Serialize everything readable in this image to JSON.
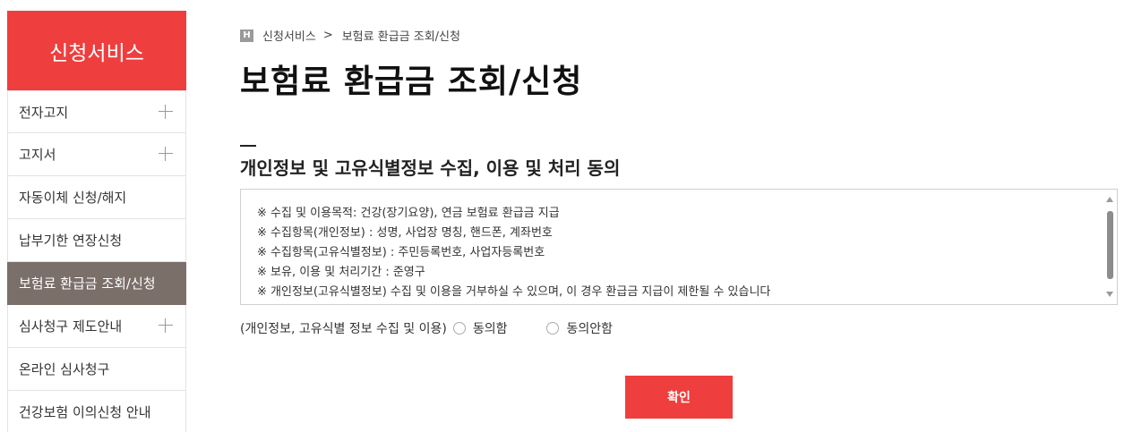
{
  "sidebar": {
    "title": "신청서비스",
    "items": [
      {
        "label": "전자고지",
        "expandable": true,
        "active": false
      },
      {
        "label": "고지서",
        "expandable": true,
        "active": false
      },
      {
        "label": "자동이체 신청/해지",
        "expandable": false,
        "active": false
      },
      {
        "label": "납부기한 연장신청",
        "expandable": false,
        "active": false
      },
      {
        "label": "보험료 환급금 조회/신청",
        "expandable": false,
        "active": true
      },
      {
        "label": "심사청구 제도안내",
        "expandable": true,
        "active": false
      },
      {
        "label": "온라인 심사청구",
        "expandable": false,
        "active": false
      },
      {
        "label": "건강보험 이의신청 안내",
        "expandable": false,
        "active": false
      }
    ]
  },
  "breadcrumb": {
    "home_icon": "H",
    "parent": "신청서비스",
    "separator": ">",
    "current": "보험료 환급금 조회/신청"
  },
  "page": {
    "title": "보험료 환급금 조회/신청",
    "section_title": "개인정보 및 고유식별정보 수집, 이용 및 처리 동의"
  },
  "terms": {
    "lines": [
      "※ 수집 및 이용목적: 건강(장기요양), 연금 보험료 환급금 지급",
      "※ 수집항목(개인정보) : 성명, 사업장 명칭, 핸드폰, 계좌번호",
      "※ 수집항목(고유식별정보) : 주민등록번호, 사업자등록번호",
      "※ 보유, 이용 및 처리기간 : 준영구",
      "※ 개인정보(고유식별정보) 수집 및 이용을 거부하실 수 있으며, 이 경우 환급금 지급이 제한될 수 있습니다"
    ]
  },
  "consent": {
    "label": "(개인정보, 고유식별 정보 수집 및 이용)",
    "agree": "동의함",
    "disagree": "동의안함",
    "selected": null
  },
  "actions": {
    "confirm": "확인"
  },
  "colors": {
    "accent": "#ef3e3e",
    "sidebar_active": "#7b6f6a"
  }
}
